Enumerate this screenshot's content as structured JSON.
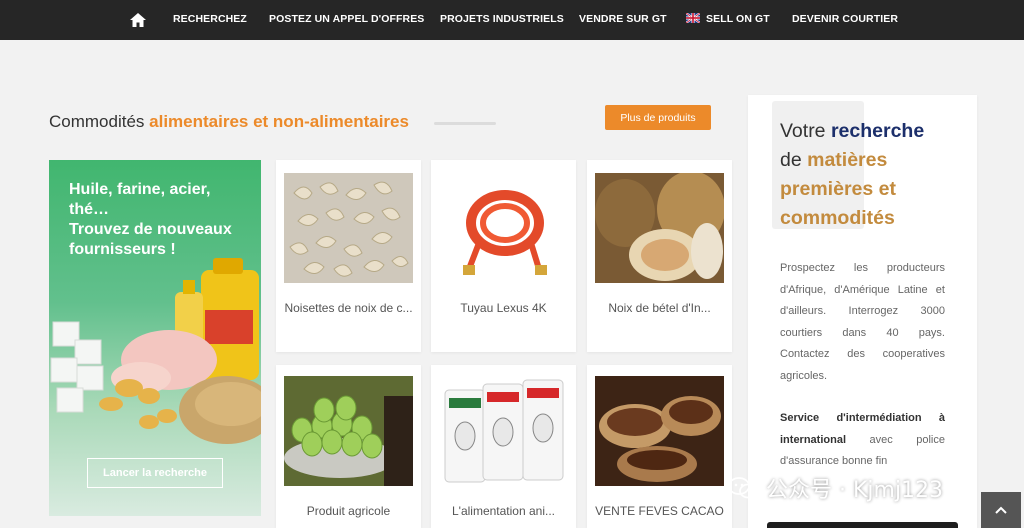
{
  "nav": {
    "items": [
      {
        "label": "RECHERCHEZ"
      },
      {
        "label": "POSTEZ UN APPEL D'OFFRES"
      },
      {
        "label": "PROJETS INDUSTRIELS"
      },
      {
        "label": "VENDRE SUR GT"
      },
      {
        "label": "SELL ON GT"
      },
      {
        "label": "DEVENIR COURTIER"
      }
    ]
  },
  "section": {
    "title_prefix": "Commodités ",
    "title_accent": "alimentaires et non-alimentaires",
    "more_button": "Plus de produits"
  },
  "promo": {
    "text": "Huile, farine, acier, thé…\nTrouvez de nouveaux fournisseurs !",
    "button": "Lancer la recherche"
  },
  "products": [
    {
      "name": "Noisettes de noix de c...",
      "image": "cashew-nuts"
    },
    {
      "name": "Tuyau Lexus 4K",
      "image": "red-hose"
    },
    {
      "name": "Noix de bétel d'In...",
      "image": "betel-nut"
    },
    {
      "name": "Produit agricole",
      "image": "green-fruits-basket"
    },
    {
      "name": "L'alimentation ani...",
      "image": "feed-bags"
    },
    {
      "name": "VENTE FEVES CACAO",
      "image": "cocoa-beans"
    }
  ],
  "sidebar": {
    "h_part1": "Votre ",
    "h_part2": "recherche",
    "h_part3": "de ",
    "h_part4": "matières premières et commodités",
    "paragraph": "Prospectez les producteurs d'Afrique, d'Amérique Latine et d'ailleurs. Interrogez 3000 courtiers dans 40 pays. Contactez des cooperatives agricoles.",
    "p2_bold": "Service d'intermédiation à international",
    "p2_rest": " avec police d'assurance bonne fin"
  },
  "watermark": {
    "text": "公众号 · Kjmj123"
  },
  "colors": {
    "accent": "#ec8a2a",
    "nav_bg": "#262626",
    "sidebar_dark": "#1c2f6b",
    "sidebar_gold": "#c38b3e"
  }
}
